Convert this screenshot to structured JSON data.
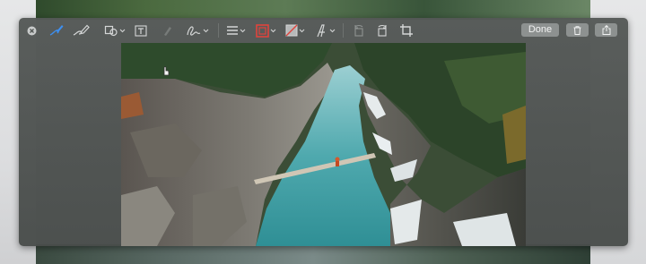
{
  "toolbar": {
    "done_label": "Done",
    "tools": [
      {
        "icon": "close-icon"
      },
      {
        "icon": "sketch-icon"
      },
      {
        "icon": "draw-icon"
      },
      {
        "icon": "shapes-icon"
      },
      {
        "icon": "text-icon"
      },
      {
        "icon": "highlight-icon"
      },
      {
        "icon": "sign-icon"
      },
      {
        "icon": "line-style-icon"
      },
      {
        "icon": "border-color-icon"
      },
      {
        "icon": "fill-color-icon"
      },
      {
        "icon": "text-style-icon"
      },
      {
        "icon": "rotate-left-icon"
      },
      {
        "icon": "rotate-right-icon"
      },
      {
        "icon": "crop-icon"
      },
      {
        "icon": "trash-icon"
      },
      {
        "icon": "share-icon"
      }
    ]
  },
  "colors": {
    "border_color_swatch": "#e0433c",
    "window_bg": "#545856",
    "button_bg": "#8d9190"
  }
}
